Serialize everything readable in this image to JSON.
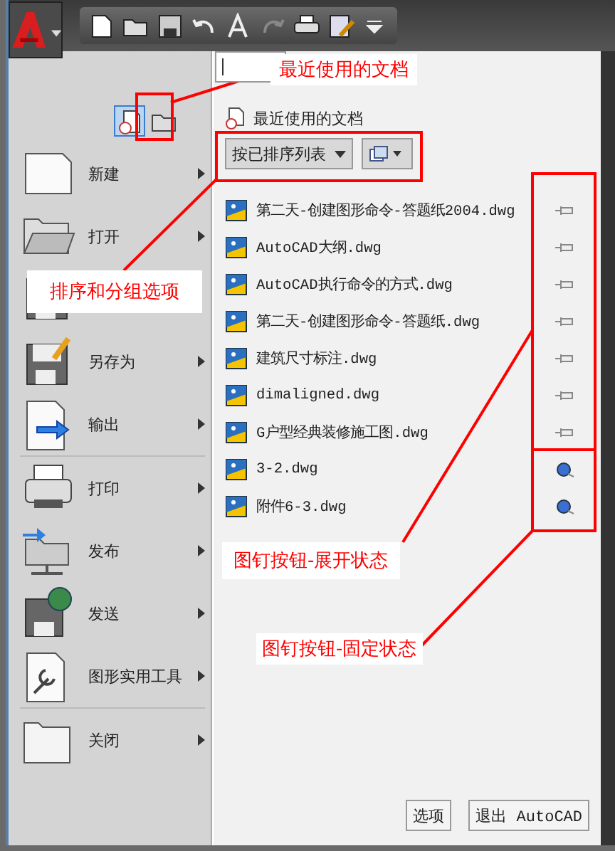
{
  "view_buttons": [
    {
      "kind": "recent",
      "selected": true
    },
    {
      "kind": "open",
      "selected": false
    }
  ],
  "menu_groups": [
    [
      {
        "kind": "new",
        "label": "新建"
      },
      {
        "kind": "open",
        "label": "打开"
      },
      {
        "kind": "save"
      },
      {
        "kind": "saveas",
        "label": "另存为"
      },
      {
        "kind": "export",
        "label": "输出"
      }
    ],
    [
      {
        "kind": "print",
        "label": "打印"
      },
      {
        "kind": "publish",
        "label": "发布"
      },
      {
        "kind": "send",
        "label": "发送"
      },
      {
        "kind": "utilities",
        "label": "图形实用工具"
      }
    ],
    [
      {
        "kind": "close",
        "label": "关闭"
      }
    ]
  ],
  "recent": {
    "title": "最近使用的文档",
    "sort_dropdown": "按已排序列表",
    "files": [
      {
        "name": "第二天-创建图形命令-答题纸2004.dwg",
        "pinned": false
      },
      {
        "name": "AutoCAD大纲.dwg",
        "pinned": false
      },
      {
        "name": "AutoCAD执行命令的方式.dwg",
        "pinned": false
      },
      {
        "name": "第二天-创建图形命令-答题纸.dwg",
        "pinned": false
      },
      {
        "name": "建筑尺寸标注.dwg",
        "pinned": false
      },
      {
        "name": "dimaligned.dwg",
        "pinned": false
      },
      {
        "name": "G户型经典装修施工图.dwg",
        "pinned": false
      },
      {
        "name": "3-2.dwg",
        "pinned": true
      },
      {
        "name": "附件6-3.dwg",
        "pinned": true
      }
    ]
  },
  "buttons": [
    "选项",
    "退出 AutoCAD"
  ],
  "annotations": [
    {
      "kind": "recent-docs",
      "text": "最近使用的文档"
    },
    {
      "kind": "sort-options",
      "text": "排序和分组选项"
    },
    {
      "kind": "pin-unpinned",
      "text": "图钉按钮-展开状态"
    },
    {
      "kind": "pin-pinned",
      "text": "图钉按钮-固定状态"
    }
  ]
}
